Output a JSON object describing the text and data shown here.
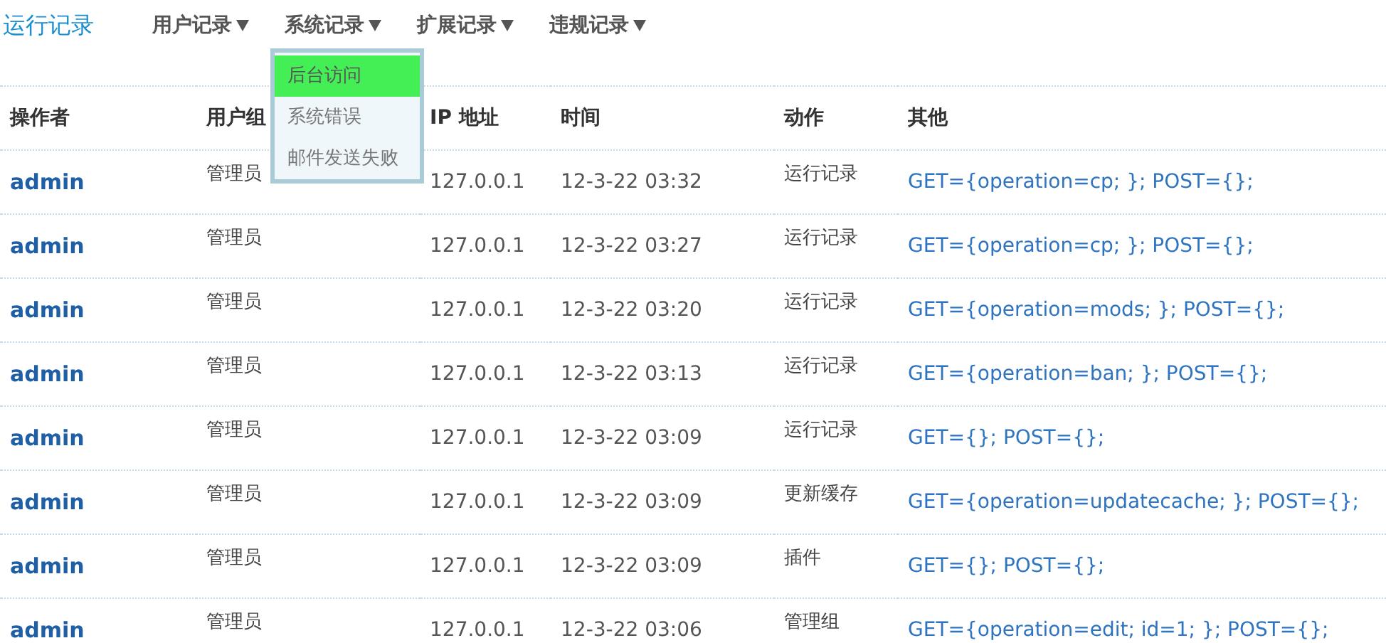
{
  "title": "运行记录",
  "nav": [
    {
      "label": "用户记录"
    },
    {
      "label": "系统记录"
    },
    {
      "label": "扩展记录"
    },
    {
      "label": "违规记录"
    }
  ],
  "dropdown": {
    "items": [
      {
        "label": "后台访问",
        "selected": true
      },
      {
        "label": "系统错误",
        "selected": false
      },
      {
        "label": "邮件发送失败",
        "selected": false
      }
    ]
  },
  "table": {
    "columns": [
      "操作者",
      "用户组",
      "IP 地址",
      "时间",
      "动作",
      "其他"
    ],
    "rows": [
      [
        "admin",
        "管理员",
        "127.0.0.1",
        "12-3-22 03:32",
        "运行记录",
        "GET={operation=cp; }; POST={};"
      ],
      [
        "admin",
        "管理员",
        "127.0.0.1",
        "12-3-22 03:27",
        "运行记录",
        "GET={operation=cp; }; POST={};"
      ],
      [
        "admin",
        "管理员",
        "127.0.0.1",
        "12-3-22 03:20",
        "运行记录",
        "GET={operation=mods; }; POST={};"
      ],
      [
        "admin",
        "管理员",
        "127.0.0.1",
        "12-3-22 03:13",
        "运行记录",
        "GET={operation=ban; }; POST={};"
      ],
      [
        "admin",
        "管理员",
        "127.0.0.1",
        "12-3-22 03:09",
        "运行记录",
        "GET={}; POST={};"
      ],
      [
        "admin",
        "管理员",
        "127.0.0.1",
        "12-3-22 03:09",
        "更新缓存",
        "GET={operation=updatecache; }; POST={};"
      ],
      [
        "admin",
        "管理员",
        "127.0.0.1",
        "12-3-22 03:09",
        "插件",
        "GET={}; POST={};"
      ],
      [
        "admin",
        "管理员",
        "127.0.0.1",
        "12-3-22 03:06",
        "管理组",
        "GET={operation=edit; id=1; }; POST={};"
      ]
    ]
  }
}
